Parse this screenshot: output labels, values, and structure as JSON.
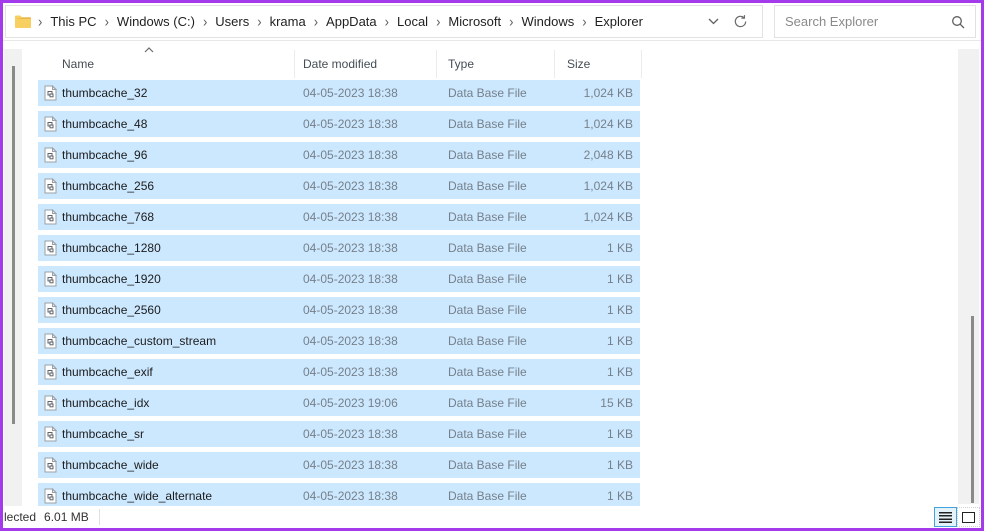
{
  "window": {
    "border_color": "#a43bea",
    "selection_color": "#cce8ff"
  },
  "breadcrumb": {
    "items": [
      "This PC",
      "Windows (C:)",
      "Users",
      "krama",
      "AppData",
      "Local",
      "Microsoft",
      "Windows",
      "Explorer"
    ]
  },
  "search": {
    "placeholder": "Search Explorer"
  },
  "columns": {
    "name": "Name",
    "date_modified": "Date modified",
    "type": "Type",
    "size": "Size",
    "sort_caret": "ˆ"
  },
  "files": [
    {
      "name": "thumbcache_32",
      "date": "04-05-2023 18:38",
      "type": "Data Base File",
      "size": "1,024 KB"
    },
    {
      "name": "thumbcache_48",
      "date": "04-05-2023 18:38",
      "type": "Data Base File",
      "size": "1,024 KB"
    },
    {
      "name": "thumbcache_96",
      "date": "04-05-2023 18:38",
      "type": "Data Base File",
      "size": "2,048 KB"
    },
    {
      "name": "thumbcache_256",
      "date": "04-05-2023 18:38",
      "type": "Data Base File",
      "size": "1,024 KB"
    },
    {
      "name": "thumbcache_768",
      "date": "04-05-2023 18:38",
      "type": "Data Base File",
      "size": "1,024 KB"
    },
    {
      "name": "thumbcache_1280",
      "date": "04-05-2023 18:38",
      "type": "Data Base File",
      "size": "1 KB"
    },
    {
      "name": "thumbcache_1920",
      "date": "04-05-2023 18:38",
      "type": "Data Base File",
      "size": "1 KB"
    },
    {
      "name": "thumbcache_2560",
      "date": "04-05-2023 18:38",
      "type": "Data Base File",
      "size": "1 KB"
    },
    {
      "name": "thumbcache_custom_stream",
      "date": "04-05-2023 18:38",
      "type": "Data Base File",
      "size": "1 KB"
    },
    {
      "name": "thumbcache_exif",
      "date": "04-05-2023 18:38",
      "type": "Data Base File",
      "size": "1 KB"
    },
    {
      "name": "thumbcache_idx",
      "date": "04-05-2023 19:06",
      "type": "Data Base File",
      "size": "15 KB"
    },
    {
      "name": "thumbcache_sr",
      "date": "04-05-2023 18:38",
      "type": "Data Base File",
      "size": "1 KB"
    },
    {
      "name": "thumbcache_wide",
      "date": "04-05-2023 18:38",
      "type": "Data Base File",
      "size": "1 KB"
    },
    {
      "name": "thumbcache_wide_alternate",
      "date": "04-05-2023 18:38",
      "type": "Data Base File",
      "size": "1 KB"
    }
  ],
  "status": {
    "selected_text": "lected",
    "size_text": "6.01 MB"
  },
  "icons": {
    "breadcrumb_folder": "folder-icon",
    "crumb_separator": "›",
    "address_dropdown": "chevron-down-icon",
    "refresh": "refresh-icon",
    "search": "search-icon",
    "file_row": "file-icon",
    "details_view": "details-view-icon",
    "icons_view": "large-icons-view-icon"
  }
}
